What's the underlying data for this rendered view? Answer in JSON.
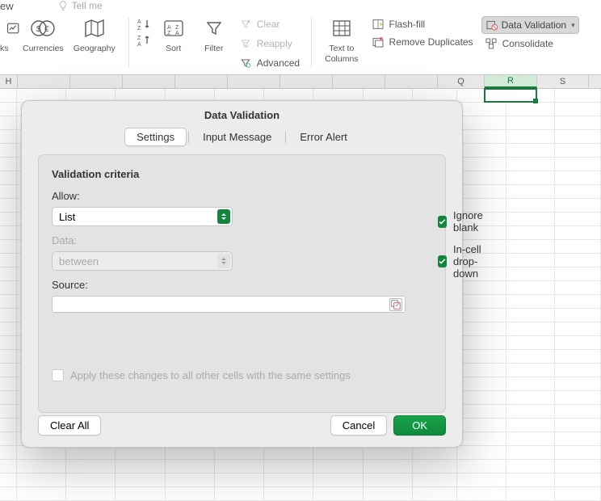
{
  "ribbon_top": {
    "tab_left": "ew",
    "tell_me": "Tell me"
  },
  "ribbon": {
    "stocks": "ks",
    "currencies": "Currencies",
    "geography": "Geography",
    "sort": "Sort",
    "filter": "Filter",
    "clear": "Clear",
    "reapply": "Reapply",
    "advanced": "Advanced",
    "text_to_columns": "Text to\nColumns",
    "flash_fill": "Flash-fill",
    "remove_duplicates": "Remove Duplicates",
    "data_validation": "Data Validation",
    "consolidate": "Consolidate"
  },
  "grid": {
    "columns": [
      "H",
      "",
      "",
      "",
      "",
      "",
      "",
      "",
      "",
      "Q",
      "R",
      "S"
    ],
    "active_column_index": 10
  },
  "dialog": {
    "title": "Data Validation",
    "tabs": {
      "settings": "Settings",
      "input_message": "Input Message",
      "error_alert": "Error Alert"
    },
    "active_tab": "Settings",
    "section_title": "Validation criteria",
    "allow_label": "Allow:",
    "allow_value": "List",
    "data_label": "Data:",
    "data_value": "between",
    "ignore_blank": "Ignore blank",
    "in_cell_dropdown": "In-cell drop-down",
    "source_label": "Source:",
    "source_value": "",
    "apply_all": "Apply these changes to all other cells with the same settings",
    "clear_all": "Clear All",
    "cancel": "Cancel",
    "ok": "OK"
  }
}
